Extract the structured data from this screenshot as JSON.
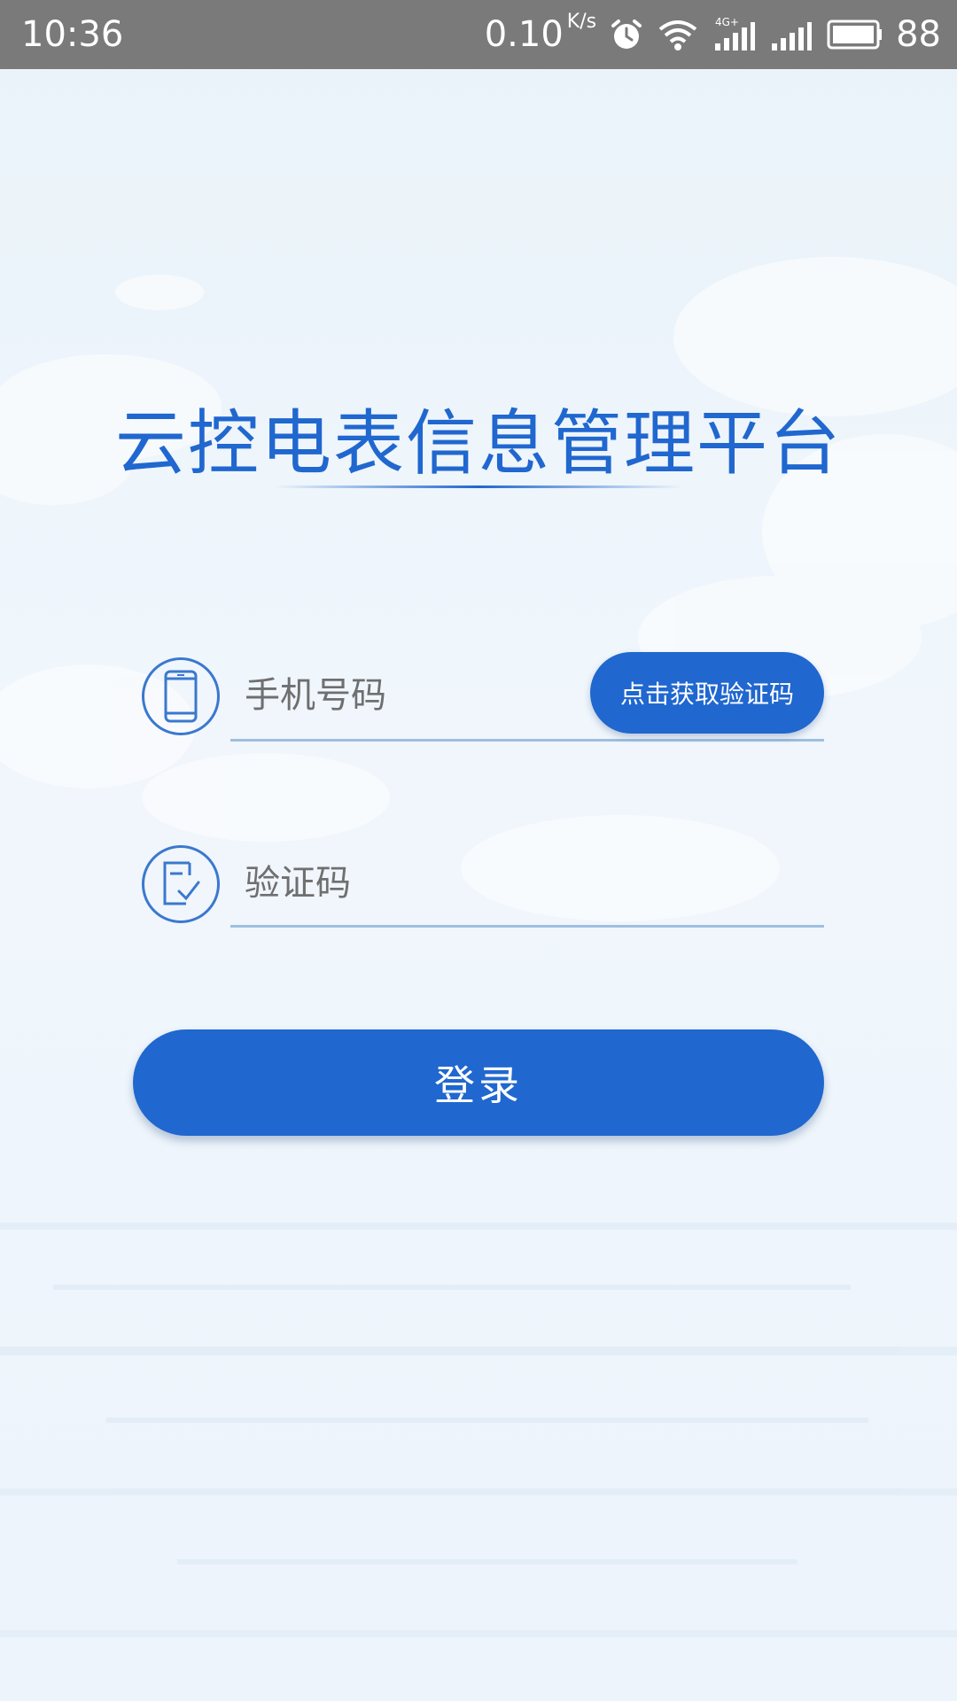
{
  "status_bar": {
    "time": "10:36",
    "net_speed": "0.10",
    "net_speed_unit": "K/s",
    "battery": "88",
    "icons": [
      "alarm-icon",
      "wifi-icon",
      "signal-4g-icon",
      "signal-icon",
      "battery-icon"
    ]
  },
  "app": {
    "title": "云控电表信息管理平台"
  },
  "form": {
    "phone": {
      "placeholder": "手机号码",
      "value": "",
      "icon": "phone-icon"
    },
    "get_code_label": "点击获取验证码",
    "code": {
      "placeholder": "验证码",
      "value": "",
      "icon": "verify-code-icon"
    },
    "login_label": "登录"
  },
  "colors": {
    "accent": "#2067cf",
    "status_bar": "#7a7a7a",
    "underline": "#9ebfe0"
  }
}
